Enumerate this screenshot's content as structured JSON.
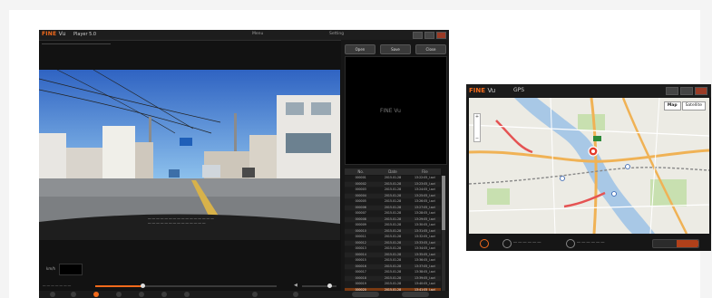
{
  "player": {
    "brand": "FINE",
    "brand_suffix": "Vu",
    "title": "Player 5.0",
    "menu_left": "Menu",
    "menu_right": "Setting",
    "buttons": [
      "Open",
      "Save",
      "Close"
    ],
    "list_columns": [
      "No.",
      "Date",
      "File"
    ],
    "list_rows": [
      [
        "000001",
        "2015.01.28",
        "13:22:05_I.avi"
      ],
      [
        "000002",
        "2015.01.28",
        "13:23:05_I.avi"
      ],
      [
        "000003",
        "2015.01.28",
        "13:24:05_I.avi"
      ],
      [
        "000004",
        "2015.01.28",
        "13:25:05_I.avi"
      ],
      [
        "000005",
        "2015.01.28",
        "13:26:05_I.avi"
      ],
      [
        "000006",
        "2015.01.28",
        "13:27:05_I.avi"
      ],
      [
        "000007",
        "2015.01.28",
        "13:28:05_I.avi"
      ],
      [
        "000008",
        "2015.01.28",
        "13:29:05_I.avi"
      ],
      [
        "000009",
        "2015.01.28",
        "13:30:05_I.avi"
      ],
      [
        "000010",
        "2015.01.28",
        "13:31:05_I.avi"
      ],
      [
        "000011",
        "2015.01.28",
        "13:32:05_I.avi"
      ],
      [
        "000012",
        "2015.01.28",
        "13:33:05_I.avi"
      ],
      [
        "000013",
        "2015.01.28",
        "13:34:05_I.avi"
      ],
      [
        "000014",
        "2015.01.28",
        "13:35:05_I.avi"
      ],
      [
        "000015",
        "2015.01.28",
        "13:36:05_I.avi"
      ],
      [
        "000016",
        "2015.01.28",
        "13:37:05_I.avi"
      ],
      [
        "000017",
        "2015.01.28",
        "13:38:05_I.avi"
      ],
      [
        "000018",
        "2015.01.28",
        "13:39:05_I.avi"
      ],
      [
        "000019",
        "2015.01.28",
        "13:40:05_I.avi"
      ],
      [
        "000020",
        "2015.01.28",
        "13:41:05_I.avi"
      ],
      [
        "000021",
        "2015.01.28",
        "13:42:05_I.avi"
      ],
      [
        "000022",
        "2015.01.28",
        "13:43:05_I.avi"
      ]
    ],
    "selected_row": 19,
    "speed_label": "km/h",
    "seek_progress": 0.26,
    "volume_level": 0.8,
    "accent": "#f26a1b"
  },
  "gps": {
    "brand": "FINE",
    "brand_suffix": "Vu",
    "title": "GPS",
    "map_types": [
      "Map",
      "Satellite"
    ],
    "accent": "#f26a1b"
  }
}
